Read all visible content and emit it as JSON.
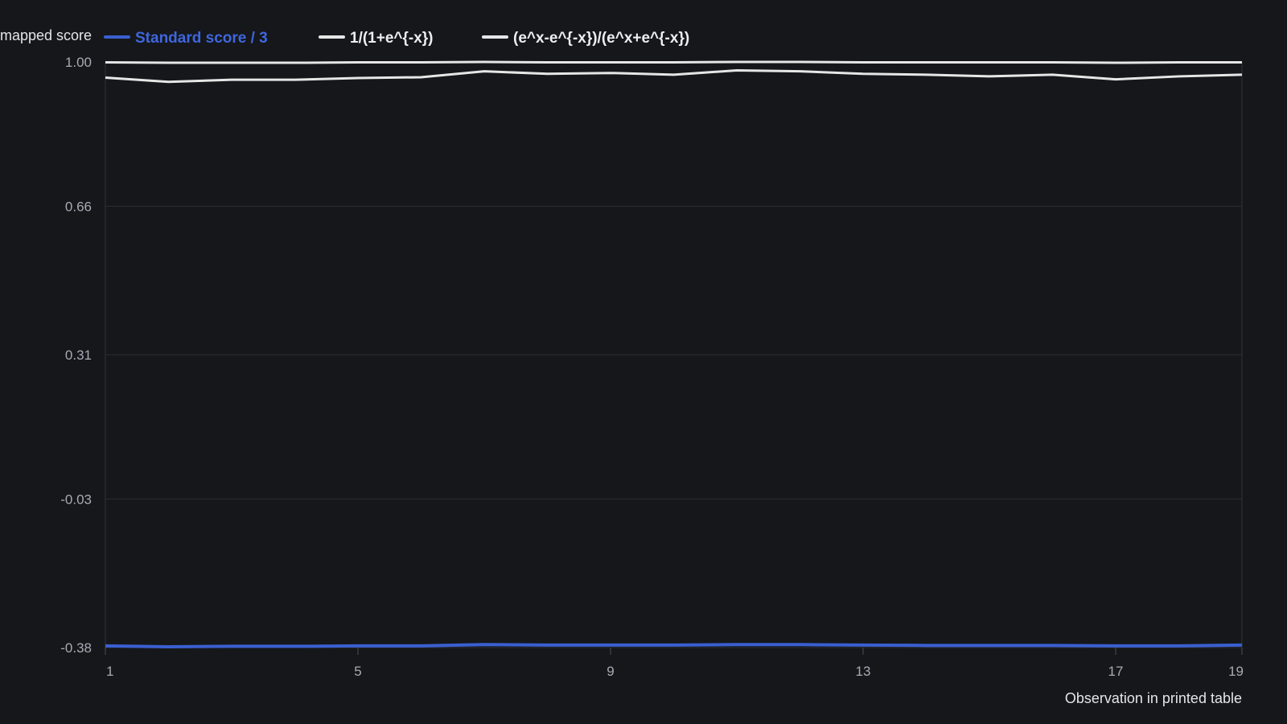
{
  "chart_data": {
    "type": "line",
    "ylabel": "mapped score",
    "xlabel": "Observation in printed table",
    "xlim": [
      1,
      19
    ],
    "ylim": [
      -0.38,
      1.0
    ],
    "x_ticks": [
      1,
      5,
      9,
      13,
      17,
      19
    ],
    "y_ticks": [
      "1.00",
      "0.66",
      "0.31",
      "-0.03",
      "-0.38"
    ],
    "grid": "horizontal",
    "legend_position": "top",
    "x": [
      1,
      2,
      3,
      4,
      5,
      6,
      7,
      8,
      9,
      10,
      11,
      12,
      13,
      14,
      15,
      16,
      17,
      18,
      19
    ],
    "series": [
      {
        "name": "Standard score / 3",
        "color": "#3a5fd0",
        "values": [
          -0.376,
          -0.378,
          -0.377,
          -0.377,
          -0.376,
          -0.376,
          -0.373,
          -0.374,
          -0.374,
          -0.374,
          -0.373,
          -0.373,
          -0.374,
          -0.375,
          -0.375,
          -0.375,
          -0.376,
          -0.376,
          -0.374
        ]
      },
      {
        "name": "1/(1+e^{-x})",
        "color": "#e6e6e6",
        "values": [
          0.963,
          0.953,
          0.958,
          0.958,
          0.962,
          0.964,
          0.978,
          0.972,
          0.974,
          0.97,
          0.98,
          0.978,
          0.972,
          0.97,
          0.966,
          0.97,
          0.959,
          0.966,
          0.97
        ]
      },
      {
        "name": "(e^x-e^{-x})/(e^x+e^{-x})",
        "color": "#e6e6e6",
        "values": [
          0.999,
          0.998,
          0.998,
          0.998,
          0.999,
          0.999,
          1.0,
          0.999,
          0.999,
          0.999,
          1.0,
          1.0,
          0.999,
          0.999,
          0.999,
          0.999,
          0.998,
          0.999,
          0.999
        ]
      }
    ]
  }
}
